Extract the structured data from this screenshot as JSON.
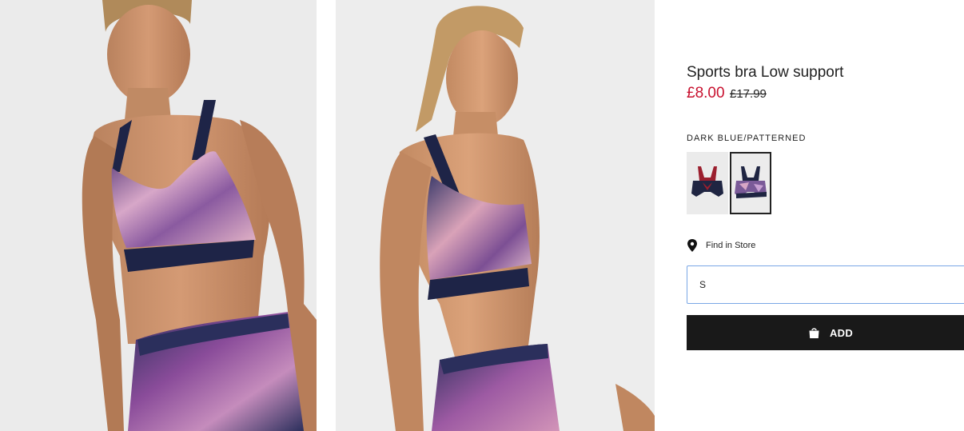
{
  "product": {
    "title": "Sports bra Low support",
    "sale_price": "£8.00",
    "original_price": "£17.99",
    "color_name": "DARK BLUE/PATTERNED",
    "selected_swatch": 2,
    "swatches": [
      {
        "label": "dark blue / burgundy straps"
      },
      {
        "label": "dark blue / patterned"
      }
    ]
  },
  "store": {
    "find_in_store_label": "Find in Store",
    "icon": "location-pin-icon"
  },
  "size": {
    "selected_value": "S"
  },
  "cart": {
    "add_label": "ADD",
    "icon": "shopping-bag-icon"
  },
  "colors": {
    "sale": "#c8102e",
    "button_bg": "#191919",
    "focus_border": "#7aa7e6"
  }
}
